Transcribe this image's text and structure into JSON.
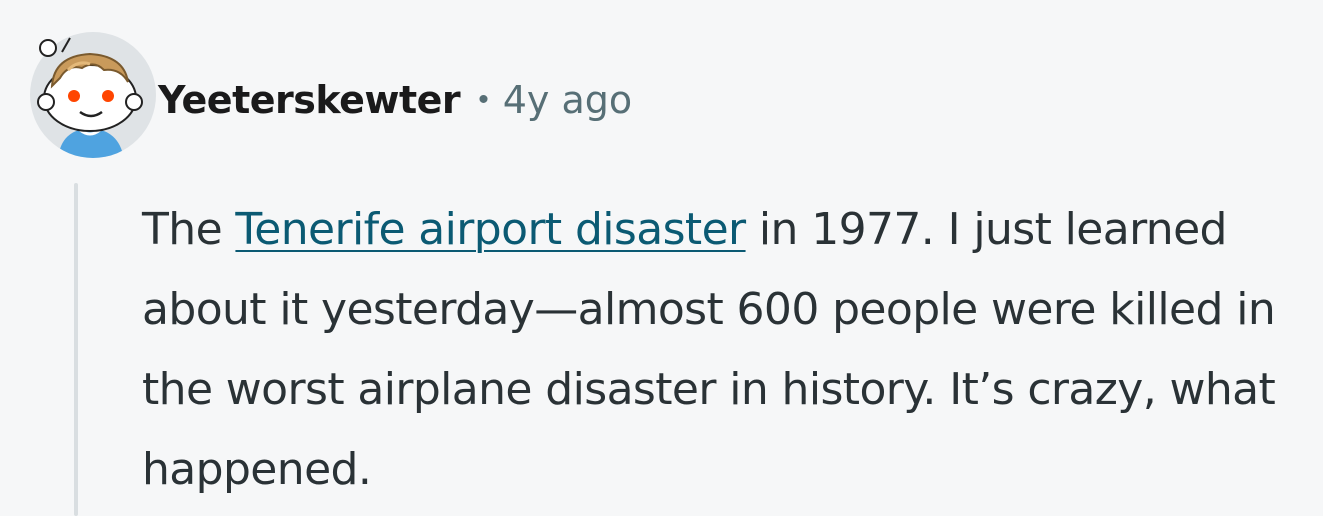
{
  "comment": {
    "author": "Yeeterskewter",
    "separator": "•",
    "timestamp": "4y ago",
    "body": {
      "text_before": "The ",
      "link_text": "Tenerife airport disaster",
      "text_after": " in 1977. I just learned about it yesterday—almost 600 people were killed in the worst airplane disaster in history. It’s crazy, what happened."
    }
  },
  "colors": {
    "background": "#f6f7f8",
    "author": "#1a1a1b",
    "meta": "#576f76",
    "body": "#2a3236",
    "link": "#0b5a73",
    "thread_line": "#d9dee1"
  },
  "icons": {
    "avatar": "reddit-snoo-avatar-icon"
  }
}
